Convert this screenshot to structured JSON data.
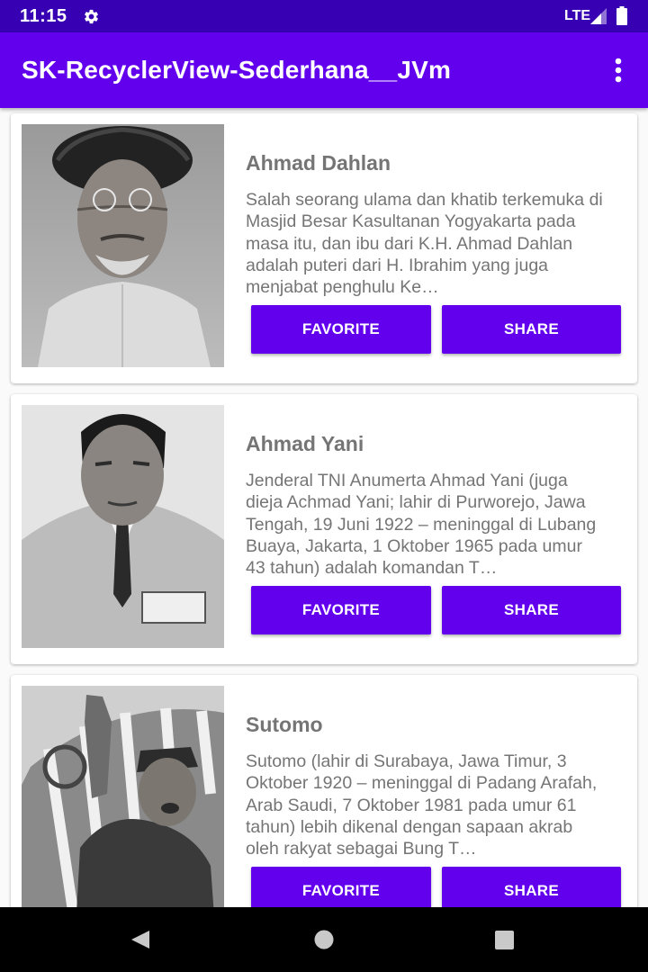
{
  "status_bar": {
    "time": "11:15",
    "network": "LTE",
    "icons": [
      "settings-gear-icon",
      "cell-signal-icon",
      "battery-icon"
    ]
  },
  "app_bar": {
    "title": "SK-RecyclerView-Sederhana__JVm",
    "menu_icon": "more-vertical-icon"
  },
  "heroes": [
    {
      "name": "Ahmad Dahlan",
      "description": "Salah seorang ulama dan khatib terkemuka di Masjid Besar Kasultanan Yogyakarta pada masa itu, dan ibu dari K.H. Ahmad Dahlan adalah puteri dari H. Ibrahim yang juga menjabat penghulu Ke…",
      "favorite_label": "FAVORITE",
      "share_label": "SHARE"
    },
    {
      "name": "Ahmad Yani",
      "description": "Jenderal TNI Anumerta Ahmad Yani (juga dieja Achmad Yani; lahir di Purworejo, Jawa Tengah, 19 Juni 1922 – meninggal di Lubang Buaya, Jakarta, 1 Oktober 1965 pada umur 43 tahun) adalah komandan T…",
      "favorite_label": "FAVORITE",
      "share_label": "SHARE"
    },
    {
      "name": "Sutomo",
      "description": "Sutomo (lahir di Surabaya, Jawa Timur, 3 Oktober 1920 – meninggal di Padang Arafah, Arab Saudi, 7 Oktober 1981 pada umur 61 tahun) lebih dikenal dengan sapaan akrab oleh rakyat sebagai Bung T…",
      "favorite_label": "FAVORITE",
      "share_label": "SHARE"
    }
  ],
  "nav_bar": {
    "icons": [
      "back-icon",
      "home-icon",
      "recents-icon"
    ]
  },
  "colors": {
    "status_bar": "#3700b3",
    "primary": "#6200ee",
    "text_secondary": "#757575",
    "card": "#ffffff",
    "background": "#fafafa"
  }
}
